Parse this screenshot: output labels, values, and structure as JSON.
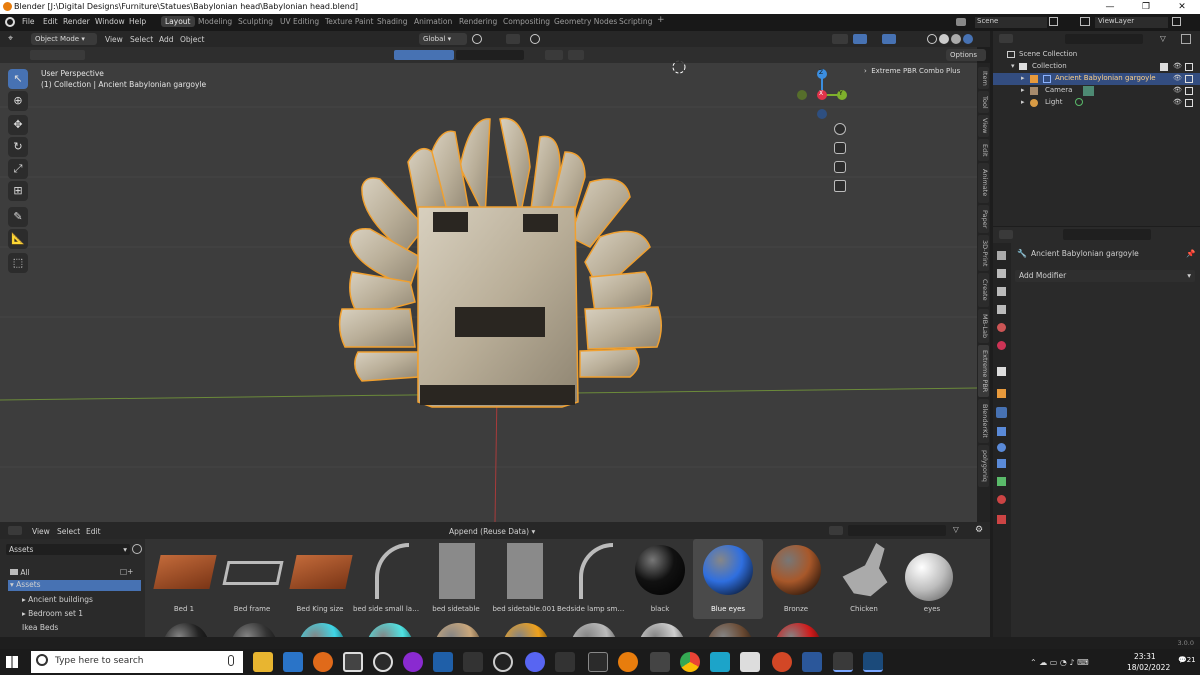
{
  "window": {
    "title": "Blender [J:\\Digital Designs\\Furniture\\Statues\\Babylonian head\\Babylonian head.blend]",
    "controls": [
      "—",
      "❐",
      "✕"
    ]
  },
  "menu": [
    "File",
    "Edit",
    "Render",
    "Window",
    "Help"
  ],
  "workspaces": [
    "Layout",
    "Modeling",
    "Sculpting",
    "UV Editing",
    "Texture Paint",
    "Shading",
    "Animation",
    "Rendering",
    "Compositing",
    "Geometry Nodes",
    "Scripting"
  ],
  "active_workspace": "Layout",
  "add_tab": "+",
  "scene": {
    "label": "Scene",
    "view_layer": "ViewLayer"
  },
  "viewport_header": {
    "mode": "Object Mode",
    "menus": [
      "View",
      "Select",
      "Add",
      "Object"
    ],
    "transform": "Global",
    "options": "Options"
  },
  "viewport": {
    "perspective": "User Perspective",
    "collection_info": "(1) Collection | Ancient Babylonian gargoyle",
    "addon_panel": "Extreme PBR Combo Plus",
    "gizmo": {
      "x": "X",
      "y": "Y",
      "z": "Z"
    }
  },
  "side_tabs": [
    "Item",
    "Tool",
    "View",
    "Edit",
    "Animate",
    "Paper",
    "3D-Print",
    "Create",
    "MB-Lab",
    "Extreme PBR",
    "BlenderKit",
    "polygoniq"
  ],
  "outliner": {
    "root": "Scene Collection",
    "collection": "Collection",
    "items": [
      {
        "name": "Ancient Babylonian gargoyle",
        "selected": true
      },
      {
        "name": "Camera",
        "selected": false
      },
      {
        "name": "Light",
        "selected": false
      }
    ]
  },
  "properties": {
    "object_name": "Ancient Babylonian gargoyle",
    "add_modifier": "Add Modifier"
  },
  "asset_browser": {
    "menus": [
      "View",
      "Select",
      "Edit"
    ],
    "import_mode": "Append (Reuse Data)",
    "library": "Assets",
    "tree": [
      {
        "label": "All",
        "level": 0
      },
      {
        "label": "Assets",
        "level": 0,
        "selected": true
      },
      {
        "label": "Ancient buildings",
        "level": 1
      },
      {
        "label": "Bedroom set 1",
        "level": 1
      },
      {
        "label": "Ikea Beds",
        "level": 0
      }
    ],
    "assets": [
      {
        "name": "Bed 1",
        "kind": "bed"
      },
      {
        "name": "Bed frame",
        "kind": "frame"
      },
      {
        "name": "Bed King size",
        "kind": "bed"
      },
      {
        "name": "bed side small lam...",
        "kind": "lamp"
      },
      {
        "name": "bed sidetable",
        "kind": "panel"
      },
      {
        "name": "bed sidetable.001",
        "kind": "panel"
      },
      {
        "name": "Bedside lamp smal...",
        "kind": "lamp"
      },
      {
        "name": "black",
        "kind": "sphere",
        "color": "#111111"
      },
      {
        "name": "Blue eyes",
        "kind": "sphere",
        "color": "#2f6fe0",
        "selected": true
      },
      {
        "name": "Bronze",
        "kind": "sphere",
        "color": "#a8582a"
      },
      {
        "name": "Chicken",
        "kind": "chicken"
      },
      {
        "name": "eyes",
        "kind": "spheres",
        "color": "#bdbdbd"
      }
    ],
    "second_row_colors": [
      "#222222",
      "#333333",
      "#3fd6e6",
      "#4fe3e3",
      "#caa77b",
      "#f0a21c",
      "#bbbbbb",
      "#cfcfcf",
      "#6a4a33",
      "#d01b1b"
    ]
  },
  "status": {
    "version": "3.0.0"
  },
  "taskbar": {
    "search_placeholder": "Type here to search",
    "time": "23:31",
    "date": "18/02/2022",
    "notifications": "21"
  },
  "colors": {
    "accent": "#4772b3",
    "selection_outline": "#f0a030",
    "viewport_bg": "#3d3d3d"
  }
}
